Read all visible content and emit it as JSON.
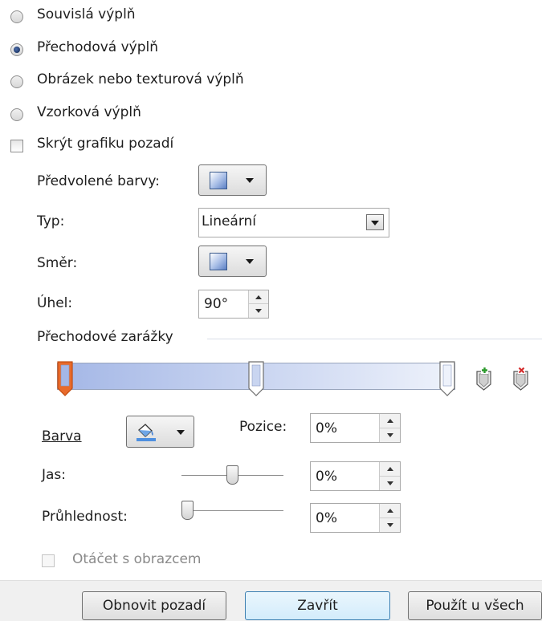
{
  "fill_options": [
    {
      "label": "Souvislá výplň",
      "selected": false
    },
    {
      "label": "Přechodová výplň",
      "selected": true
    },
    {
      "label": "Obrázek nebo texturová výplň",
      "selected": false
    },
    {
      "label": "Vzorková výplň",
      "selected": false
    }
  ],
  "hide_background": {
    "label": "Skrýt grafiku pozadí",
    "checked": false
  },
  "preset": {
    "label": "Předvolené barvy:"
  },
  "type": {
    "label": "Typ:",
    "value": "Lineární"
  },
  "direction": {
    "label": "Směr:"
  },
  "angle": {
    "label": "Úhel:",
    "value": "90°"
  },
  "stops": {
    "title": "Přechodové zarážky",
    "positions": [
      0,
      0.5,
      1
    ],
    "selected_index": 0,
    "add_icon": "add-stop-icon",
    "remove_icon": "remove-stop-icon"
  },
  "color": {
    "label": "Barva",
    "icon": "paint-bucket-icon"
  },
  "position": {
    "label": "Pozice:",
    "value": "0%"
  },
  "brightness": {
    "label": "Jas:",
    "value": "0%",
    "level": 0.5
  },
  "transparency": {
    "label": "Průhlednost:",
    "value": "0%",
    "level": 0
  },
  "rotate_with_shape": {
    "label": "Otáčet s obrazcem",
    "checked": false,
    "disabled": true
  },
  "buttons": {
    "reset": "Obnovit pozadí",
    "close": "Zavřít",
    "apply_all": "Použít u všech"
  },
  "colors": {
    "accent_stop": "#e86a2b",
    "gradient_start": "#a4b7e6",
    "gradient_end": "#eef2fb",
    "disabled_text": "#8a8a8a"
  }
}
